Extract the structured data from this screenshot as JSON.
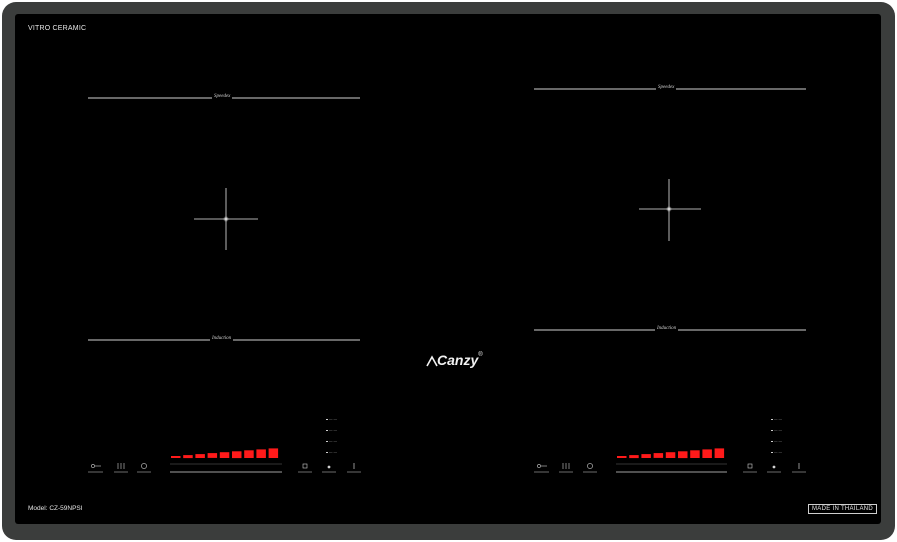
{
  "hob": {
    "top_left_label": "VITRO CERAMIC",
    "model_label": "Model: CZ-59NPSI",
    "origin_label": "MADE IN THAILAND",
    "brand": "Canzy",
    "brand_mark": "®",
    "colors": {
      "frame": "#3b3d3c",
      "glass": "#000000",
      "line": "#cfcfcf",
      "power_bar": "#ff1a1a"
    },
    "left_zone": {
      "top_label": "Speedex",
      "bottom_label": "Induction",
      "power_bars": 9,
      "level_labels": [
        "— —",
        "— —",
        "— —",
        "— —"
      ],
      "controls": [
        "lock-icon",
        "heat-waves-icon",
        "timer-icon",
        "power-bar-slider",
        "boost-icon",
        "zone-icon",
        "power-icon"
      ]
    },
    "right_zone": {
      "top_label": "Speedex",
      "bottom_label": "Induction",
      "power_bars": 9,
      "level_labels": [
        "— —",
        "— —",
        "— —",
        "— —"
      ],
      "controls": [
        "lock-icon",
        "heat-waves-icon",
        "timer-icon",
        "power-bar-slider",
        "boost-icon",
        "zone-icon",
        "power-icon"
      ]
    }
  }
}
